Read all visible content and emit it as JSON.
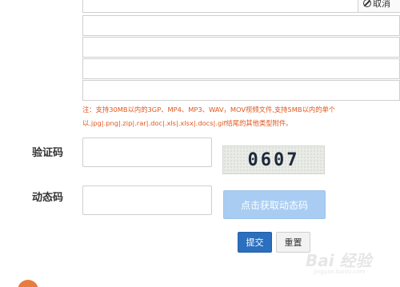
{
  "upload": {
    "cancel_label": "取消",
    "note": "注：支持30MB以内的3GP、MP4、MP3、WAV，MOV视频文件,支持5MB以内的单个以.jpg|.png|.zip|.rar|.doc|.xls|.xlsx|.docs|.gif结尾的其他类型附件。"
  },
  "captcha": {
    "label": "验证码",
    "code": "0607"
  },
  "dynamic_code": {
    "label": "动态码",
    "button_label": "点击获取动态码"
  },
  "actions": {
    "submit_label": "提交",
    "reset_label": "重置"
  },
  "watermark": {
    "logo": "Bai 经验",
    "sub": "jingyan.baidu.com"
  },
  "colors": {
    "note": "#e2561d",
    "primary": "#2b6fbe",
    "dyn_button": "#a9cdf2"
  }
}
